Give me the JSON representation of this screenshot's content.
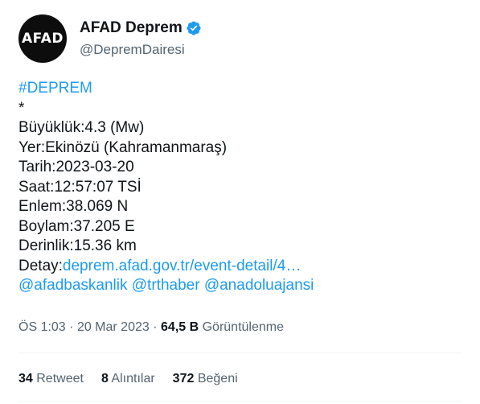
{
  "account": {
    "avatar_text": "AFAD",
    "display_name": "AFAD Deprem",
    "handle": "@DepremDairesi"
  },
  "tweet": {
    "hashtag": "#DEPREM",
    "star": "*",
    "lines": [
      "Büyüklük:4.3 (Mw)",
      "Yer:Ekinözü (Kahramanmaraş)",
      "Tarih:2023-03-20",
      "Saat:12:57:07 TSİ",
      "Enlem:38.069 N",
      "Boylam:37.205 E",
      "Derinlik:15.36 km"
    ],
    "detail_label": "Detay:",
    "detail_link": "deprem.afad.gov.tr/event-detail/4…",
    "mentions": [
      "@afadbaskanlik",
      "@trthaber",
      "@anadoluajansi"
    ]
  },
  "meta": {
    "time": "ÖS 1:03",
    "date": "20 Mar 2023",
    "views_count": "64,5 B",
    "views_label": "Görüntülenme"
  },
  "stats": {
    "retweets_count": "34",
    "retweets_label": "Retweet",
    "quotes_count": "8",
    "quotes_label": "Alıntılar",
    "likes_count": "372",
    "likes_label": "Beğeni"
  },
  "colors": {
    "link": "#1d9bf0",
    "verified": "#1d9bf0",
    "secondary_text": "#536471"
  },
  "icons": {
    "verified": "verified-badge-icon"
  }
}
